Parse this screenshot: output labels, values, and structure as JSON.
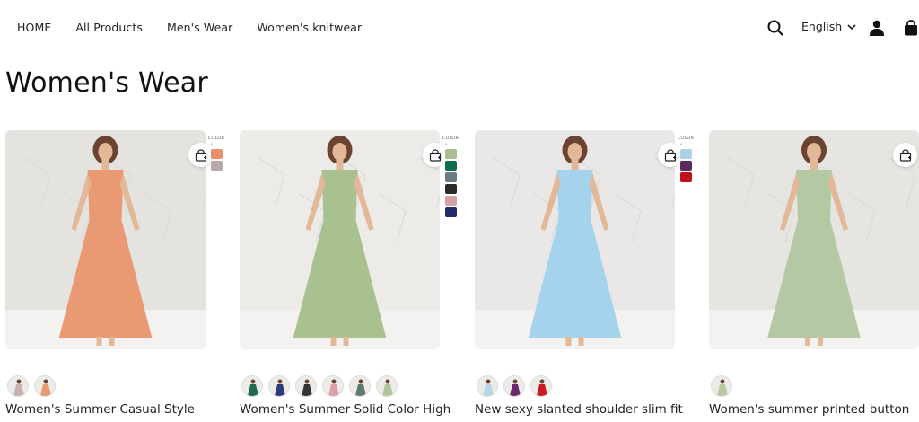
{
  "nav": {
    "links": [
      "HOME",
      "All Products",
      "Men's Wear",
      "Women's knitwear"
    ],
    "language": "English",
    "icons": [
      "search-icon",
      "chevron-down-icon",
      "user-icon",
      "shopping-bag-icon"
    ]
  },
  "page": {
    "title": "Women's Wear"
  },
  "colors": {
    "text": "#111111",
    "background": "#ffffff"
  },
  "products": [
    {
      "name": "Women's Summer Casual Style",
      "color_label": "COLOR",
      "swatches": [
        "#e8916a",
        "#b9a8a8"
      ],
      "thumbs": [
        "#c9b2ae",
        "#e59a72"
      ],
      "dress": "#ea9a72",
      "bg": "#e4e3e0"
    },
    {
      "name": "Women's Summer Solid Color High",
      "color_label": "COLOR",
      "swatches": [
        "#a9bd92",
        "#0f6b4e",
        "#6a7b86",
        "#2a2a2a",
        "#d7a0a6",
        "#232a6e"
      ],
      "thumbs": [
        "#1f6a4a",
        "#2a3a7a",
        "#333333",
        "#d9a0a8",
        "#5e7a6a",
        "#b2c49a"
      ],
      "dress": "#a9c08f",
      "bg": "#ecebe8"
    },
    {
      "name": "New sexy slanted shoulder slim fit",
      "color_label": "COLOR",
      "swatches": [
        "#a9d1e8",
        "#5a2a5a",
        "#c0101a"
      ],
      "thumbs": [
        "#b6d8e6",
        "#6a2a6a",
        "#c81c22"
      ],
      "dress": "#a5d2ec",
      "bg": "#e9e8e6"
    },
    {
      "name": "Women's summer printed button",
      "color_label": "",
      "swatches": [],
      "thumbs": [
        "#b9c9a2"
      ],
      "dress": "#b4c8a4",
      "bg": "#e6e5e2"
    }
  ]
}
